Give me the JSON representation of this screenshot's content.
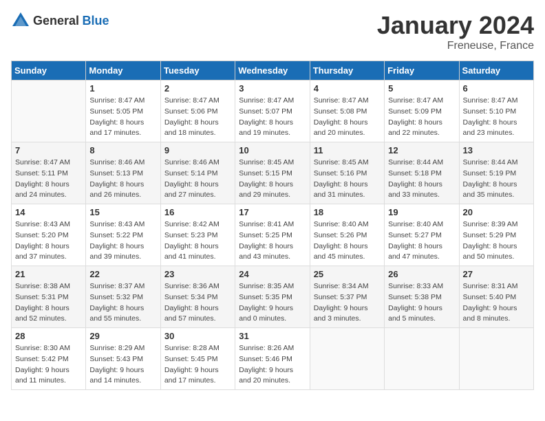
{
  "header": {
    "logo_general": "General",
    "logo_blue": "Blue",
    "title": "January 2024",
    "location": "Freneuse, France"
  },
  "calendar": {
    "days_of_week": [
      "Sunday",
      "Monday",
      "Tuesday",
      "Wednesday",
      "Thursday",
      "Friday",
      "Saturday"
    ],
    "weeks": [
      [
        {
          "day": "",
          "sunrise": "",
          "sunset": "",
          "daylight": ""
        },
        {
          "day": "1",
          "sunrise": "Sunrise: 8:47 AM",
          "sunset": "Sunset: 5:05 PM",
          "daylight": "Daylight: 8 hours and 17 minutes."
        },
        {
          "day": "2",
          "sunrise": "Sunrise: 8:47 AM",
          "sunset": "Sunset: 5:06 PM",
          "daylight": "Daylight: 8 hours and 18 minutes."
        },
        {
          "day": "3",
          "sunrise": "Sunrise: 8:47 AM",
          "sunset": "Sunset: 5:07 PM",
          "daylight": "Daylight: 8 hours and 19 minutes."
        },
        {
          "day": "4",
          "sunrise": "Sunrise: 8:47 AM",
          "sunset": "Sunset: 5:08 PM",
          "daylight": "Daylight: 8 hours and 20 minutes."
        },
        {
          "day": "5",
          "sunrise": "Sunrise: 8:47 AM",
          "sunset": "Sunset: 5:09 PM",
          "daylight": "Daylight: 8 hours and 22 minutes."
        },
        {
          "day": "6",
          "sunrise": "Sunrise: 8:47 AM",
          "sunset": "Sunset: 5:10 PM",
          "daylight": "Daylight: 8 hours and 23 minutes."
        }
      ],
      [
        {
          "day": "7",
          "sunrise": "Sunrise: 8:47 AM",
          "sunset": "Sunset: 5:11 PM",
          "daylight": "Daylight: 8 hours and 24 minutes."
        },
        {
          "day": "8",
          "sunrise": "Sunrise: 8:46 AM",
          "sunset": "Sunset: 5:13 PM",
          "daylight": "Daylight: 8 hours and 26 minutes."
        },
        {
          "day": "9",
          "sunrise": "Sunrise: 8:46 AM",
          "sunset": "Sunset: 5:14 PM",
          "daylight": "Daylight: 8 hours and 27 minutes."
        },
        {
          "day": "10",
          "sunrise": "Sunrise: 8:45 AM",
          "sunset": "Sunset: 5:15 PM",
          "daylight": "Daylight: 8 hours and 29 minutes."
        },
        {
          "day": "11",
          "sunrise": "Sunrise: 8:45 AM",
          "sunset": "Sunset: 5:16 PM",
          "daylight": "Daylight: 8 hours and 31 minutes."
        },
        {
          "day": "12",
          "sunrise": "Sunrise: 8:44 AM",
          "sunset": "Sunset: 5:18 PM",
          "daylight": "Daylight: 8 hours and 33 minutes."
        },
        {
          "day": "13",
          "sunrise": "Sunrise: 8:44 AM",
          "sunset": "Sunset: 5:19 PM",
          "daylight": "Daylight: 8 hours and 35 minutes."
        }
      ],
      [
        {
          "day": "14",
          "sunrise": "Sunrise: 8:43 AM",
          "sunset": "Sunset: 5:20 PM",
          "daylight": "Daylight: 8 hours and 37 minutes."
        },
        {
          "day": "15",
          "sunrise": "Sunrise: 8:43 AM",
          "sunset": "Sunset: 5:22 PM",
          "daylight": "Daylight: 8 hours and 39 minutes."
        },
        {
          "day": "16",
          "sunrise": "Sunrise: 8:42 AM",
          "sunset": "Sunset: 5:23 PM",
          "daylight": "Daylight: 8 hours and 41 minutes."
        },
        {
          "day": "17",
          "sunrise": "Sunrise: 8:41 AM",
          "sunset": "Sunset: 5:25 PM",
          "daylight": "Daylight: 8 hours and 43 minutes."
        },
        {
          "day": "18",
          "sunrise": "Sunrise: 8:40 AM",
          "sunset": "Sunset: 5:26 PM",
          "daylight": "Daylight: 8 hours and 45 minutes."
        },
        {
          "day": "19",
          "sunrise": "Sunrise: 8:40 AM",
          "sunset": "Sunset: 5:27 PM",
          "daylight": "Daylight: 8 hours and 47 minutes."
        },
        {
          "day": "20",
          "sunrise": "Sunrise: 8:39 AM",
          "sunset": "Sunset: 5:29 PM",
          "daylight": "Daylight: 8 hours and 50 minutes."
        }
      ],
      [
        {
          "day": "21",
          "sunrise": "Sunrise: 8:38 AM",
          "sunset": "Sunset: 5:31 PM",
          "daylight": "Daylight: 8 hours and 52 minutes."
        },
        {
          "day": "22",
          "sunrise": "Sunrise: 8:37 AM",
          "sunset": "Sunset: 5:32 PM",
          "daylight": "Daylight: 8 hours and 55 minutes."
        },
        {
          "day": "23",
          "sunrise": "Sunrise: 8:36 AM",
          "sunset": "Sunset: 5:34 PM",
          "daylight": "Daylight: 8 hours and 57 minutes."
        },
        {
          "day": "24",
          "sunrise": "Sunrise: 8:35 AM",
          "sunset": "Sunset: 5:35 PM",
          "daylight": "Daylight: 9 hours and 0 minutes."
        },
        {
          "day": "25",
          "sunrise": "Sunrise: 8:34 AM",
          "sunset": "Sunset: 5:37 PM",
          "daylight": "Daylight: 9 hours and 3 minutes."
        },
        {
          "day": "26",
          "sunrise": "Sunrise: 8:33 AM",
          "sunset": "Sunset: 5:38 PM",
          "daylight": "Daylight: 9 hours and 5 minutes."
        },
        {
          "day": "27",
          "sunrise": "Sunrise: 8:31 AM",
          "sunset": "Sunset: 5:40 PM",
          "daylight": "Daylight: 9 hours and 8 minutes."
        }
      ],
      [
        {
          "day": "28",
          "sunrise": "Sunrise: 8:30 AM",
          "sunset": "Sunset: 5:42 PM",
          "daylight": "Daylight: 9 hours and 11 minutes."
        },
        {
          "day": "29",
          "sunrise": "Sunrise: 8:29 AM",
          "sunset": "Sunset: 5:43 PM",
          "daylight": "Daylight: 9 hours and 14 minutes."
        },
        {
          "day": "30",
          "sunrise": "Sunrise: 8:28 AM",
          "sunset": "Sunset: 5:45 PM",
          "daylight": "Daylight: 9 hours and 17 minutes."
        },
        {
          "day": "31",
          "sunrise": "Sunrise: 8:26 AM",
          "sunset": "Sunset: 5:46 PM",
          "daylight": "Daylight: 9 hours and 20 minutes."
        },
        {
          "day": "",
          "sunrise": "",
          "sunset": "",
          "daylight": ""
        },
        {
          "day": "",
          "sunrise": "",
          "sunset": "",
          "daylight": ""
        },
        {
          "day": "",
          "sunrise": "",
          "sunset": "",
          "daylight": ""
        }
      ]
    ]
  }
}
